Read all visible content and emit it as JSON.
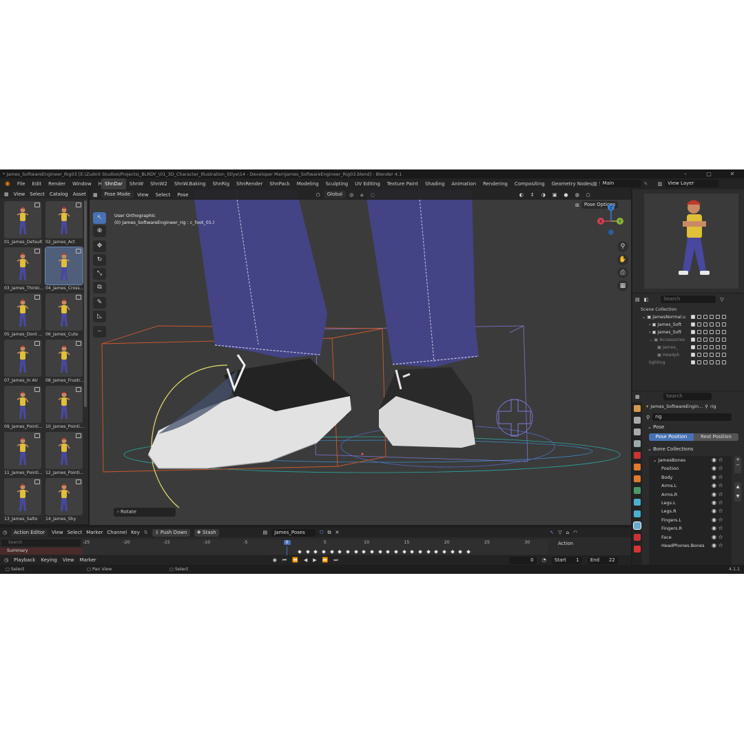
{
  "titlebar": {
    "title": "* James_SoftwareEngineer_Rig03 [E:\\Zudnit Studios\\Projects\\_BLRDY_\\01_3D_Character_Illustration_Stlye\\14 - Developer Man\\James_SoftwareEngineer_Rig03.blend] - Blender 4.1"
  },
  "menu": [
    "File",
    "Edit",
    "Render",
    "Window",
    "Help"
  ],
  "workspaces": [
    "ShnDar",
    "ShnW",
    "ShnW2",
    "ShnW.Baking",
    "ShnRig",
    "ShnRender",
    "ShnPack",
    "Modeling",
    "Sculpting",
    "UV Editing",
    "Texture Paint",
    "Shading",
    "Animation",
    "Rendering",
    "Compositing",
    "Geometry Nodes",
    "Scripting"
  ],
  "active_workspace": "ShnDar",
  "scene": "Main",
  "view_layer": "View Layer",
  "asset_browser": {
    "menu": [
      "View",
      "Select",
      "Catalog",
      "Asset"
    ],
    "items": [
      "01_James_Default",
      "02_James_Act",
      "03_James_Thinki...",
      "04_James_Cross...",
      "05_James_Dont ...",
      "06_James_Cute",
      "07_James_In Air",
      "08_James_Frustr...",
      "09_James_Pointi...",
      "10_James_Pointi...",
      "11_James_Pointi...",
      "12_James_Pointi...",
      "13_James_Salto",
      "14_James_Shy"
    ],
    "selected_index": 3
  },
  "viewport": {
    "mode": "Pose Mode",
    "menu": [
      "View",
      "Select",
      "Pose"
    ],
    "transform_orientation": "Global",
    "pose_options": "Pose Options",
    "view_name": "User Orthographic",
    "object_info": "(0) James_SoftwareEngineer_rig : c_foot_01.l",
    "last_op": "Rotate",
    "gizmo_axes": [
      "X",
      "Y",
      "Z"
    ]
  },
  "outliner": {
    "search_placeholder": "Search",
    "root": "Scene Collection",
    "rows": [
      "JamesNormal.u",
      "James_Soft",
      "James_Soft",
      "Accessories",
      "James_",
      "Headph",
      "lighting"
    ]
  },
  "properties": {
    "search_placeholder": "Search",
    "object_name": "James_SoftwareEngin...",
    "armature_name": "rig",
    "data_name": "rig",
    "pose_section": "Pose",
    "pose_position": "Pose Position",
    "rest_position": "Rest Position",
    "bone_collections_section": "Bone Collections",
    "collections": [
      "JamesBones",
      "Position",
      "Body",
      "Arms.L",
      "Arms.R",
      "Legs.L",
      "Legs.R",
      "Fingers.L",
      "Fingers.R",
      "Face",
      "HeadPhones.Bones"
    ]
  },
  "dopesheet": {
    "editor": "Action Editor",
    "menu": [
      "View",
      "Select",
      "Marker",
      "Channel",
      "Key"
    ],
    "push_down": "Push Down",
    "stash": "Stash",
    "action": "James_Poses",
    "search_placeholder": "Search",
    "summary": "Summary",
    "ruler": [
      "-25",
      "-20",
      "-15",
      "-10",
      "-5",
      "0",
      "5",
      "10",
      "15",
      "20",
      "25",
      "30"
    ],
    "current_frame_marker": "0",
    "side_panel": "Action"
  },
  "playback": {
    "menu": [
      "Playback",
      "Keying",
      "View",
      "Marker"
    ],
    "current_frame": "0",
    "start_label": "Start",
    "start": "1",
    "end_label": "End",
    "end": "22"
  },
  "statusbar": {
    "left": "Select",
    "middle": "Pan View",
    "right": "Select",
    "version": "4.1.1"
  },
  "colors": {
    "accent": "#4772b3",
    "header": "#232323",
    "panel": "#2b2b2b",
    "viewport_bg": "#3b3b3b"
  }
}
